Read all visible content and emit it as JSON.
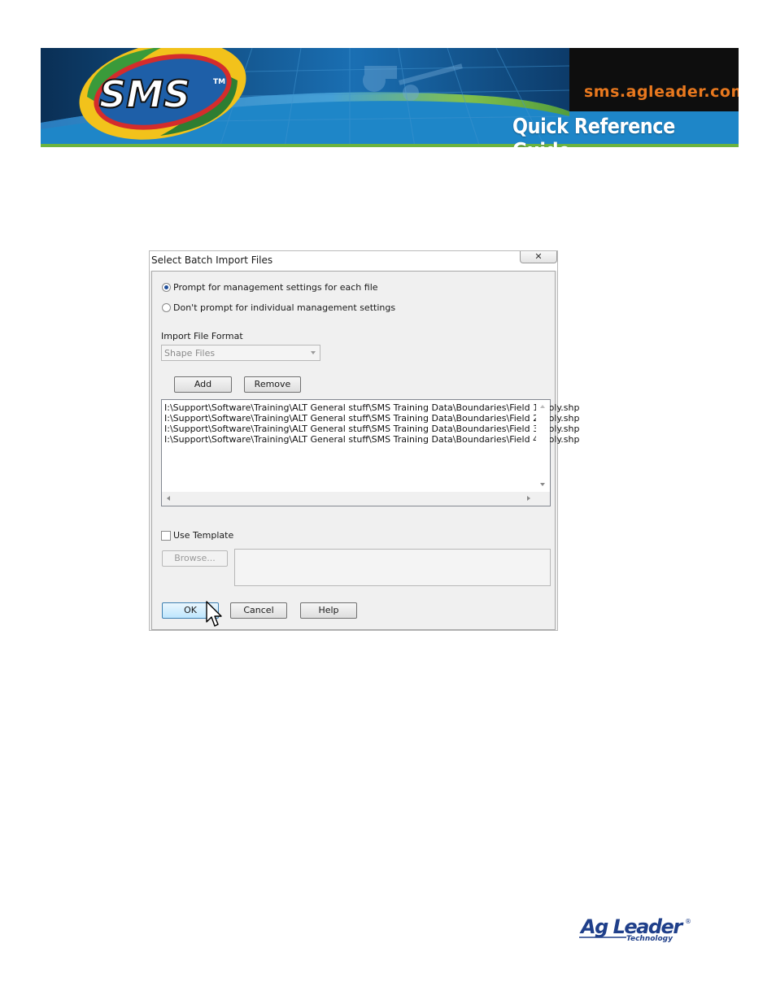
{
  "banner": {
    "logo_text": "SMS",
    "logo_tm": "TM",
    "url": "sms.agleader.com",
    "guide_title": "Quick Reference Guide"
  },
  "dialog": {
    "title": "Select Batch Import Files",
    "close_glyph": "✕",
    "radio_prompt_each": "Prompt for management settings for each file",
    "radio_no_prompt": "Don't prompt for individual management settings",
    "selected_option": "radio_prompt_each",
    "format_label": "Import File Format",
    "format_value": "Shape Files",
    "add_label": "Add",
    "remove_label": "Remove",
    "files": [
      "I:\\Support\\Software\\Training\\ALT General stuff\\SMS Training Data\\Boundaries\\Field 1_poly.shp",
      "I:\\Support\\Software\\Training\\ALT General stuff\\SMS Training Data\\Boundaries\\Field 2_poly.shp",
      "I:\\Support\\Software\\Training\\ALT General stuff\\SMS Training Data\\Boundaries\\Field 3_poly.shp",
      "I:\\Support\\Software\\Training\\ALT General stuff\\SMS Training Data\\Boundaries\\Field 4_poly.shp"
    ],
    "use_template_label": "Use Template",
    "use_template_checked": false,
    "browse_label": "Browse...",
    "ok_label": "OK",
    "cancel_label": "Cancel",
    "help_label": "Help"
  },
  "footer": {
    "brand": "Ag Leader",
    "brand_sub": "Technology",
    "registered": "®"
  },
  "colors": {
    "banner_blue": "#1d7fc0",
    "banner_dark": "#0b1d33",
    "url_orange": "#e8781e",
    "logo_red": "#d42c2c",
    "logo_green": "#3a9a3a",
    "logo_yellow": "#f2c21b",
    "agleader_blue": "#1f3f8a"
  }
}
